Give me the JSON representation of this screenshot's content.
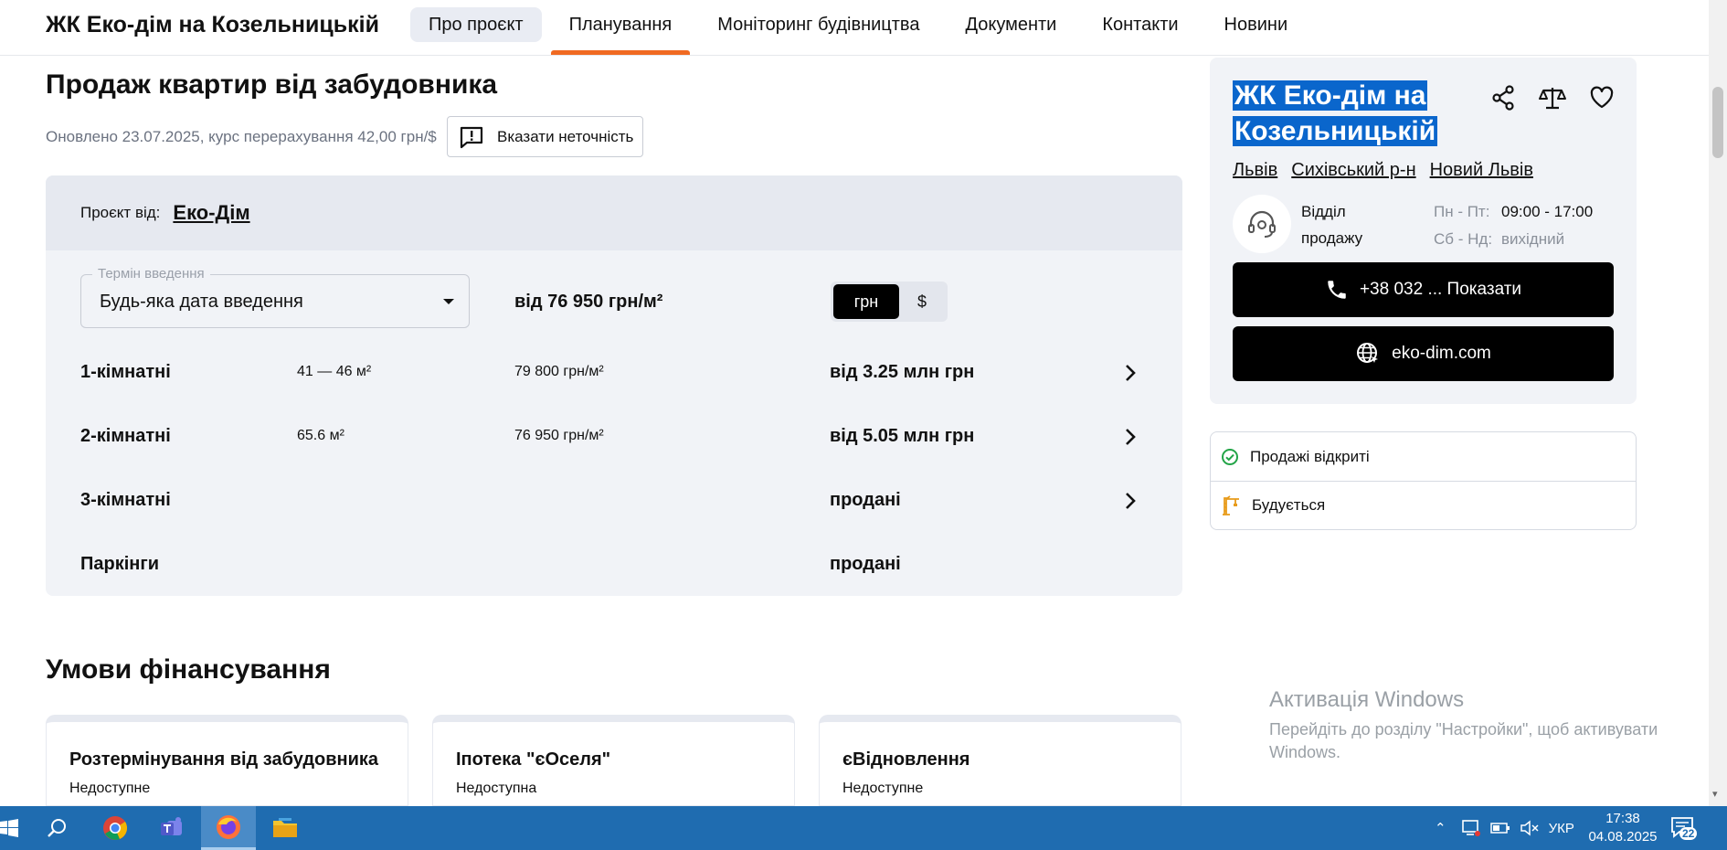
{
  "nav": {
    "brand": "ЖК Еко-дім на Козельницькій",
    "links": [
      "Про проєкт",
      "Планування",
      "Моніторинг будівництва",
      "Документи",
      "Контакти",
      "Новини"
    ]
  },
  "main": {
    "title": "Продаж квартир від забудовника",
    "updated": "Оновлено 23.07.2025, курс перерахування 42,00 грн/$",
    "report_label": "Вказати неточність",
    "project_from_label": "Проєкт від:",
    "developer": "Еко-Дім",
    "term_legend": "Термін введення",
    "term_value": "Будь-яка дата введення",
    "from_price": "від 76 950 грн/м²",
    "currency": [
      "грн",
      "$"
    ],
    "rows": [
      {
        "type": "1-кімнатні",
        "area": "41 — 46 м²",
        "price_m2": "79 800 грн/м²",
        "total": "від 3.25 млн грн"
      },
      {
        "type": "2-кімнатні",
        "area": "65.6 м²",
        "price_m2": "76 950 грн/м²",
        "total": "від 5.05 млн грн"
      },
      {
        "type": "3-кімнатні",
        "area": "",
        "price_m2": "",
        "total": "продані"
      },
      {
        "type": "Паркінги",
        "area": "",
        "price_m2": "",
        "total": "продані"
      }
    ],
    "financing_title": "Умови фінансування",
    "financing": [
      {
        "title": "Розтермінування від забудовника",
        "status": "Недоступне"
      },
      {
        "title": "Іпотека \"єОселя\"",
        "status": "Недоступна"
      },
      {
        "title": "єВідновлення",
        "status": "Недоступне"
      }
    ]
  },
  "side": {
    "title_line1": "ЖК Еко-дім на",
    "title_line2": "Козельницькій",
    "locations": [
      "Львів",
      "Сихівський р-н",
      "Новий Львів"
    ],
    "dept_line1": "Відділ",
    "dept_line2": "продажу",
    "weekday_label": "Пн - Пт:",
    "weekday_hours": "09:00 - 17:00",
    "weekend_label": "Сб - Нд:",
    "weekend_hours": "вихідний",
    "phone_label": "+38 032 ... Показати",
    "site_label": "eko-dim.com",
    "statuses": [
      "Продажі відкриті",
      "Будується"
    ],
    "colors": {
      "selection": "#0a66cc",
      "accent": "#f06a22",
      "ok": "#22a447",
      "build": "#e89b1a"
    }
  },
  "watermark": {
    "line1": "Активація Windows",
    "line2": "Перейдіть до розділу \"Настройки\", щоб активувати Windows."
  },
  "taskbar": {
    "lang": "УКР",
    "time": "17:38",
    "date": "04.08.2025",
    "notifications": "22"
  }
}
